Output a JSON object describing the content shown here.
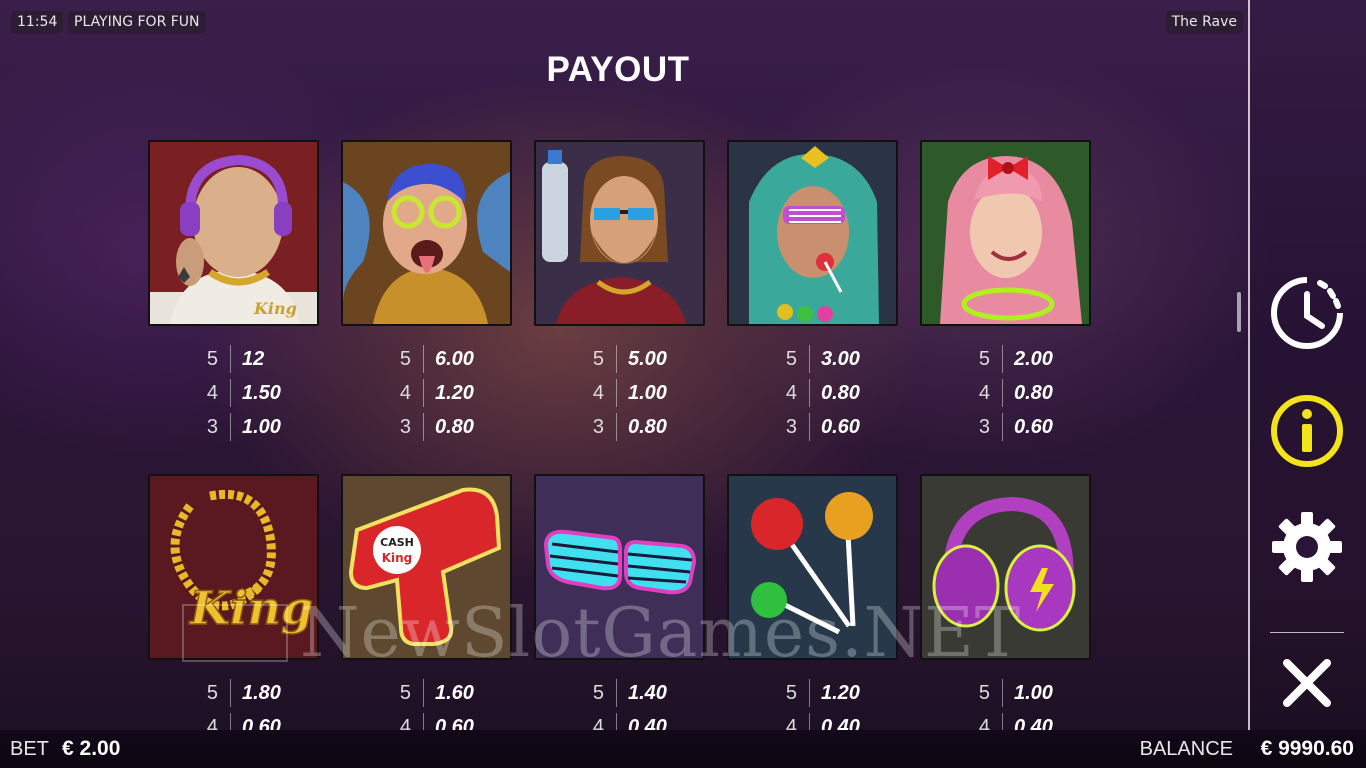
{
  "topbar": {
    "clock": "11:54",
    "mode": "PLAYING FOR FUN",
    "game_title": "The Rave"
  },
  "payout_title": "PAYOUT",
  "row1": [
    {
      "symbol": "bald-tattooed-man",
      "pays": [
        [
          "5",
          "12"
        ],
        [
          "4",
          "1.50"
        ],
        [
          "3",
          "1.00"
        ]
      ]
    },
    {
      "symbol": "fairy-raver",
      "pays": [
        [
          "5",
          "6.00"
        ],
        [
          "4",
          "1.20"
        ],
        [
          "3",
          "0.80"
        ]
      ]
    },
    {
      "symbol": "bearded-man-sunglasses",
      "pays": [
        [
          "5",
          "5.00"
        ],
        [
          "4",
          "1.00"
        ],
        [
          "3",
          "0.80"
        ]
      ]
    },
    {
      "symbol": "dreadlocks-woman-lollipop",
      "pays": [
        [
          "5",
          "3.00"
        ],
        [
          "4",
          "0.80"
        ],
        [
          "3",
          "0.60"
        ]
      ]
    },
    {
      "symbol": "pink-hair-girl",
      "pays": [
        [
          "5",
          "2.00"
        ],
        [
          "4",
          "0.80"
        ],
        [
          "3",
          "0.60"
        ]
      ]
    }
  ],
  "row2": [
    {
      "symbol": "gold-king-chain",
      "pays": [
        [
          "5",
          "1.80"
        ],
        [
          "4",
          "0.60"
        ]
      ]
    },
    {
      "symbol": "cash-gun",
      "text": "CASH is King",
      "pays": [
        [
          "5",
          "1.60"
        ],
        [
          "4",
          "0.60"
        ]
      ]
    },
    {
      "symbol": "shutter-shades",
      "pays": [
        [
          "5",
          "1.40"
        ],
        [
          "4",
          "0.40"
        ]
      ]
    },
    {
      "symbol": "lollipops",
      "pays": [
        [
          "5",
          "1.20"
        ],
        [
          "4",
          "0.40"
        ]
      ]
    },
    {
      "symbol": "headphones",
      "pays": [
        [
          "5",
          "1.00"
        ],
        [
          "4",
          "0.40"
        ]
      ]
    }
  ],
  "chain_text": "King",
  "sidebar": {
    "icons": [
      "history-icon",
      "info-icon",
      "settings-icon",
      "close-icon"
    ]
  },
  "bottombar": {
    "bet_label": "BET",
    "bet_value": "€ 2.00",
    "balance_label": "BALANCE",
    "balance_value": "€ 9990.60"
  },
  "watermark": "NewSlotGames.NET",
  "colors": {
    "info_yellow": "#f2e31b",
    "background": "#2a1538"
  }
}
